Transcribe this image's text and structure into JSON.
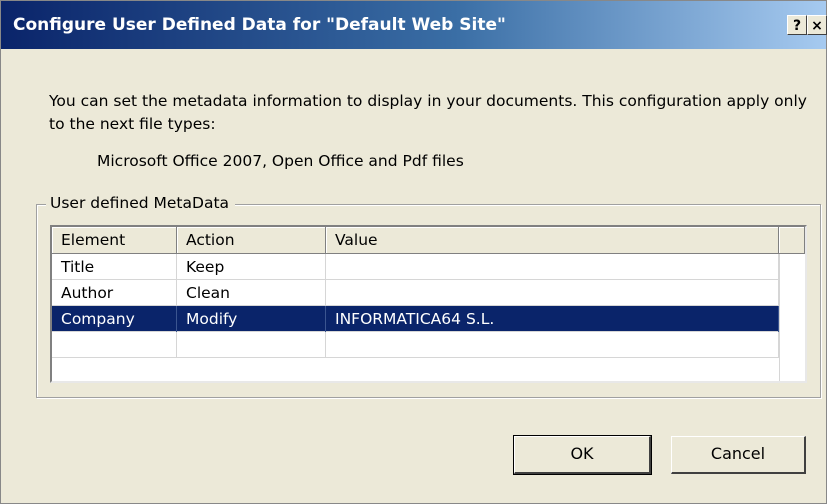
{
  "window": {
    "title": "Configure User Defined Data for \"Default Web Site\"",
    "help_label": "?",
    "close_label": "×"
  },
  "description": "You can set the metadata information to display in your documents. This configuration apply only to the next file types:",
  "file_types": "Microsoft Office 2007, Open Office and Pdf files",
  "group": {
    "label": "User defined MetaData"
  },
  "table": {
    "columns": [
      "Element",
      "Action",
      "Value"
    ],
    "rows": [
      {
        "element": "Title",
        "action": "Keep",
        "value": ""
      },
      {
        "element": "Author",
        "action": "Clean",
        "value": ""
      },
      {
        "element": "Company",
        "action": "Modify",
        "value": "INFORMATICA64 S.L.",
        "selected": true
      },
      {
        "element": "",
        "action": "",
        "value": ""
      }
    ]
  },
  "buttons": {
    "ok": "OK",
    "cancel": "Cancel"
  },
  "colors": {
    "selection": "#0a246a",
    "dialog_bg": "#ece9d8"
  }
}
